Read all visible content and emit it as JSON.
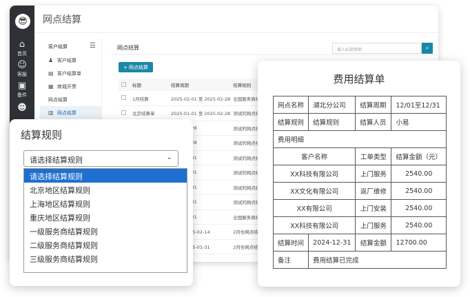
{
  "app": {
    "title": "网点结算",
    "rail": [
      {
        "icon": "⌂",
        "label": "首页"
      },
      {
        "icon": "☺",
        "label": "客服"
      },
      {
        "icon": "▣",
        "label": "备件"
      },
      {
        "icon": "☻",
        "label": ""
      }
    ],
    "menu": {
      "head": "客户结算",
      "items": [
        {
          "icon": "♟",
          "label": "客户结算"
        },
        {
          "icon": "▤",
          "label": "客户结算单"
        },
        {
          "icon": "▦",
          "label": "商城开票"
        },
        {
          "icon": "",
          "label": "网点结算"
        },
        {
          "icon": "▥",
          "label": "网点结算"
        }
      ]
    },
    "content": {
      "title": "网点结算",
      "search_placeholder": "输入标题搜索",
      "add_label": "+ 网点结算",
      "columns": [
        "",
        "标题",
        "结算周期",
        "结算规则"
      ],
      "rows": [
        {
          "title": "1月结算",
          "period": "2025-02-01 至 2025-02-28",
          "rule": "全国服务商结"
        },
        {
          "title": "北京结算单",
          "period": "2025-01-01 至 2025-02-28",
          "rule": "测试的网点结"
        },
        {
          "title": "",
          "period": "2025-02-28",
          "rule": "测试的网点结"
        },
        {
          "title": "",
          "period": "2025-02-28",
          "rule": "测试的网点结"
        },
        {
          "title": "",
          "period": "2025-01-31",
          "rule": "测试的网点结"
        },
        {
          "title": "",
          "period": "2024-12-01",
          "rule": "测试的网点结"
        },
        {
          "title": "",
          "period": "2025-01-31",
          "rule": "测试的网点结"
        },
        {
          "title": "",
          "period": "2025-01-31",
          "rule": "测试的网点结"
        },
        {
          "title": "",
          "period": "2025-01-31",
          "rule": "全国服务商结"
        },
        {
          "title": "",
          "period": "14 至 2025-02-14",
          "rule": "2月份网点结"
        },
        {
          "title": "",
          "period": "01 至 2025-01-31",
          "rule": "2月份网点结"
        }
      ]
    }
  },
  "rule_card": {
    "title": "结算规则",
    "select_value": "请选择结算规则",
    "options": [
      "请选择结算规则",
      "北京地区结算规则",
      "上海地区结算规则",
      "重庆地区结算规则",
      "一级服务商结算规则",
      "二级服务商结算规则",
      "三级服务商结算规则"
    ]
  },
  "bill": {
    "title": "费用结算单",
    "branch_label": "网点名称",
    "branch_value": "湖北分公司",
    "period_label": "结算周期",
    "period_value": "12/01至12/31",
    "rule_label": "结算规则",
    "rule_value": "结算规则",
    "person_label": "结算人员",
    "person_value": "小易",
    "detail_label": "费用明细",
    "detail_headers": [
      "客户名称",
      "工单类型",
      "结算金额（元）"
    ],
    "details": [
      {
        "customer": "XX科技有限公司",
        "type": "上门服务",
        "amount": "2540.00"
      },
      {
        "customer": "XX文化有限公司",
        "type": "返厂维修",
        "amount": "2540.00"
      },
      {
        "customer": "XX有限公司",
        "type": "上门安装",
        "amount": "2540.00"
      },
      {
        "customer": "XX科技有限公司",
        "type": "上门服务",
        "amount": "2540.00"
      }
    ],
    "time_label": "结算时间",
    "time_value": "2024-12-31",
    "total_label": "结算金额",
    "total_value": "12700.00",
    "note_label": "备注",
    "note_value": "费用结算已完成"
  }
}
